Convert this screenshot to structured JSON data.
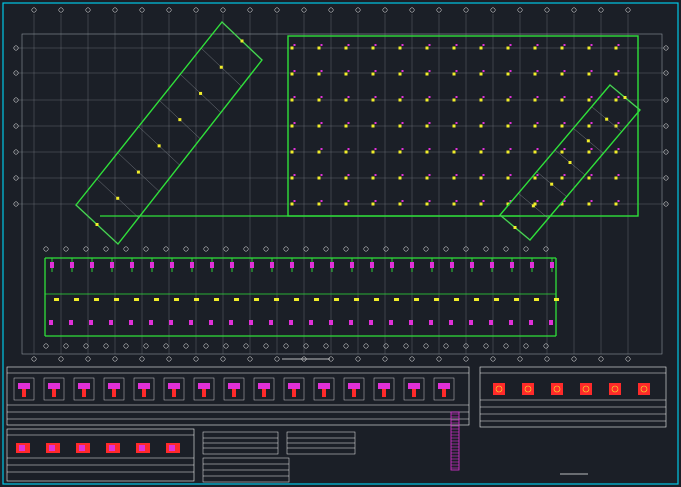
{
  "drawing": {
    "plan_title": "",
    "sheet_title": ""
  },
  "colors": {
    "background": "#1b1f27",
    "frame": "#00c8e6",
    "axis_line": "#8e939b",
    "wall": "#2fe03a",
    "column_yellow": "#f2ee2a",
    "column_magenta": "#e030d8",
    "red": "#ff2a2a",
    "white": "#f0f0f0"
  },
  "tables": {
    "column_sections_title": "",
    "wall_sections_title": "",
    "pier_table_title": "",
    "small_table_a_title": "",
    "small_table_b_title": ""
  }
}
